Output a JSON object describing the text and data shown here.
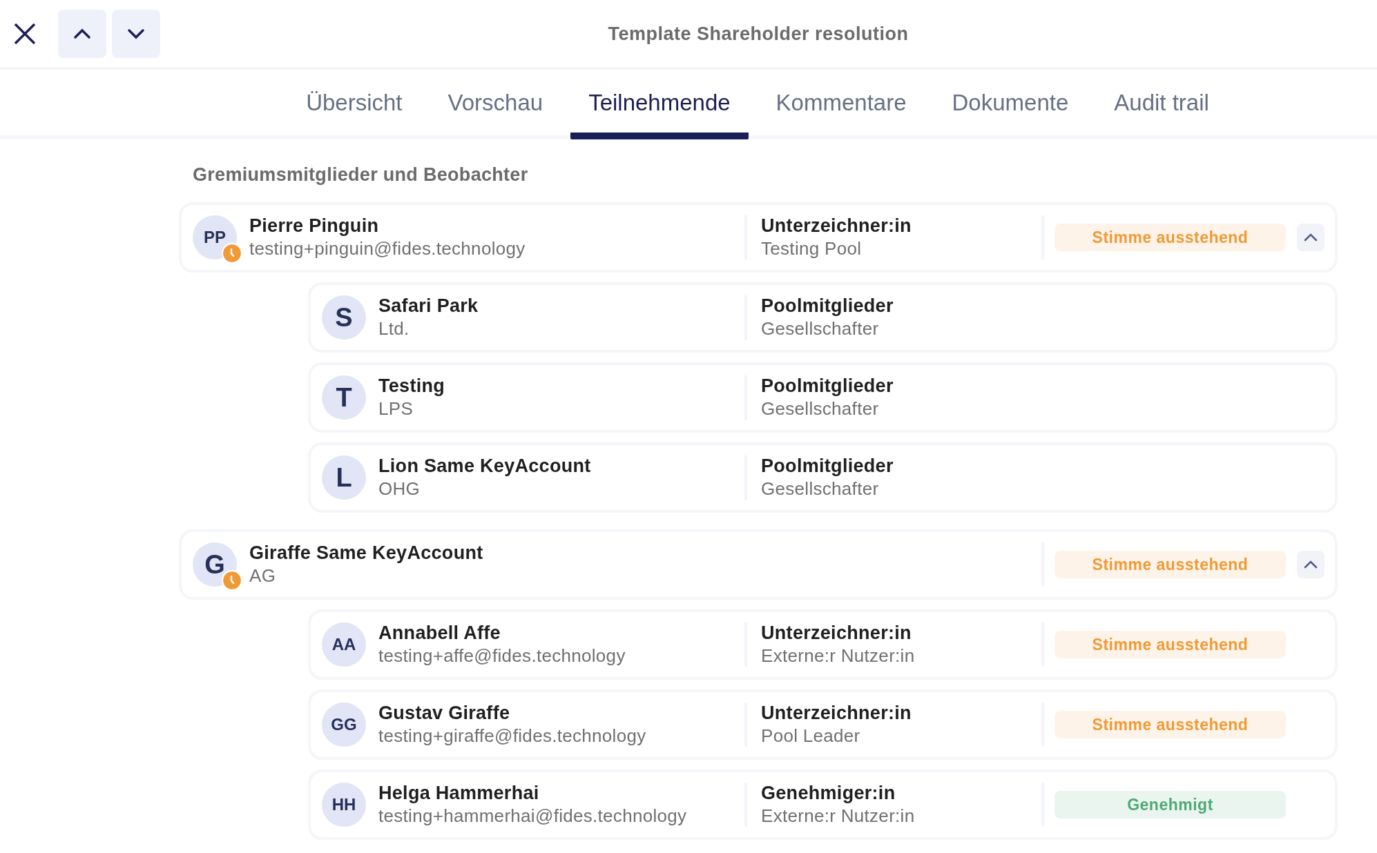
{
  "toolbar": {
    "title": "Template Shareholder resolution"
  },
  "tabs": [
    {
      "label": "Übersicht",
      "selected": false
    },
    {
      "label": "Vorschau",
      "selected": false
    },
    {
      "label": "Teilnehmende",
      "selected": true
    },
    {
      "label": "Kommentare",
      "selected": false
    },
    {
      "label": "Dokumente",
      "selected": false
    },
    {
      "label": "Audit trail",
      "selected": false
    }
  ],
  "section": {
    "heading": "Gremiumsmitglieder und Beobachter"
  },
  "groups": [
    {
      "initials": "PP",
      "name": "Pierre Pinguin",
      "subtitle": "testing+pinguin@fides.technology",
      "pending": true,
      "role": "Unterzeichner:in",
      "role_detail": "Testing Pool",
      "status": {
        "label": "Stimme ausstehend",
        "kind": "pending"
      },
      "expanded": true,
      "children": [
        {
          "initials": "S",
          "name": "Safari Park",
          "subtitle": "Ltd.",
          "role": "Poolmitglieder",
          "role_detail": "Gesellschafter"
        },
        {
          "initials": "T",
          "name": "Testing",
          "subtitle": "LPS",
          "role": "Poolmitglieder",
          "role_detail": "Gesellschafter"
        },
        {
          "initials": "L",
          "name": "Lion Same KeyAccount",
          "subtitle": "OHG",
          "role": "Poolmitglieder",
          "role_detail": "Gesellschafter"
        }
      ]
    },
    {
      "initials": "G",
      "name": "Giraffe Same KeyAccount",
      "subtitle": "AG",
      "pending": true,
      "status": {
        "label": "Stimme ausstehend",
        "kind": "pending"
      },
      "expanded": true,
      "children": [
        {
          "initials": "AA",
          "name": "Annabell Affe",
          "subtitle": "testing+affe@fides.technology",
          "role": "Unterzeichner:in",
          "role_detail": "Externe:r Nutzer:in",
          "status": {
            "label": "Stimme ausstehend",
            "kind": "pending"
          }
        },
        {
          "initials": "GG",
          "name": "Gustav Giraffe",
          "subtitle": "testing+giraffe@fides.technology",
          "role": "Unterzeichner:in",
          "role_detail": "Pool Leader",
          "status": {
            "label": "Stimme ausstehend",
            "kind": "pending"
          }
        },
        {
          "initials": "HH",
          "name": "Helga Hammerhai",
          "subtitle": "testing+hammerhai@fides.technology",
          "role": "Genehmiger:in",
          "role_detail": "Externe:r Nutzer:in",
          "status": {
            "label": "Genehmigt",
            "kind": "approved"
          }
        }
      ]
    }
  ]
}
